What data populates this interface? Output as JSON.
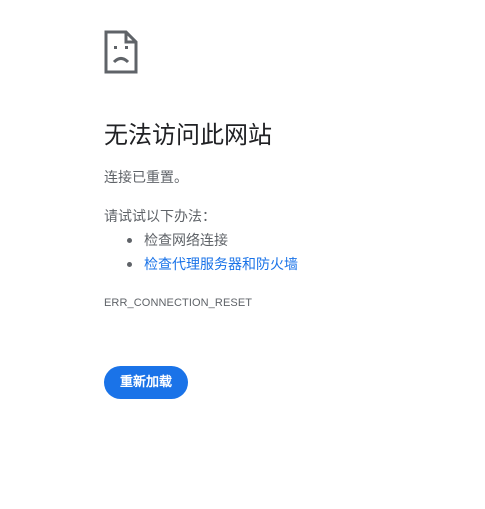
{
  "icon": "sad-page-icon",
  "headline": "无法访问此网站",
  "message": "连接已重置。",
  "try_title": "请试试以下办法：",
  "suggestions": [
    {
      "label": "检查网络连接",
      "is_link": false
    },
    {
      "label": "检查代理服务器和防火墙",
      "is_link": true
    }
  ],
  "error_code": "ERR_CONNECTION_RESET",
  "reload_label": "重新加载",
  "colors": {
    "accent": "#1a73e8",
    "text_primary": "#202124",
    "text_secondary": "#5f6368"
  }
}
